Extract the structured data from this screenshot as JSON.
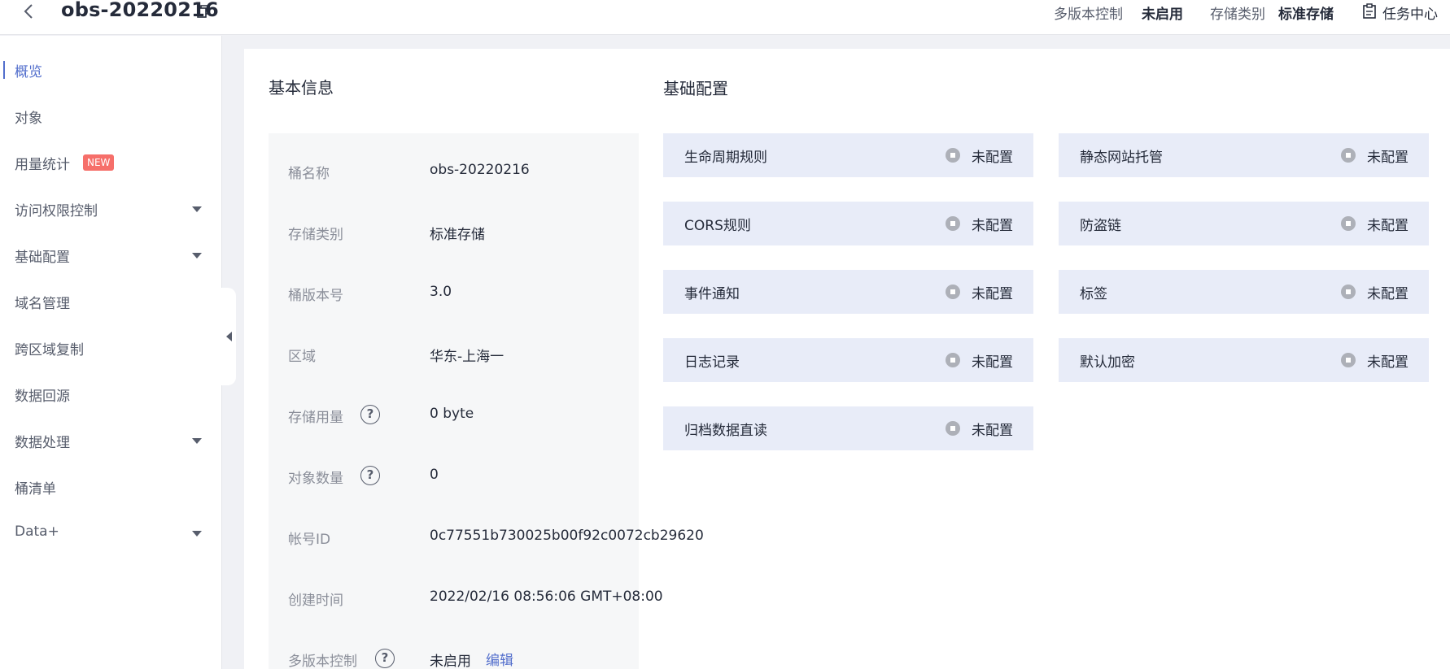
{
  "header": {
    "bucket_name": "obs-20220216",
    "versioning_label": "多版本控制",
    "versioning_value": "未启用",
    "storage_label": "存储类别",
    "storage_value": "标准存储",
    "task_center": "任务中心"
  },
  "sidebar": {
    "items": [
      {
        "label": "概览",
        "active": true
      },
      {
        "label": "对象"
      },
      {
        "label": "用量统计",
        "badge": "NEW"
      },
      {
        "label": "访问权限控制",
        "expandable": true
      },
      {
        "label": "基础配置",
        "expandable": true
      },
      {
        "label": "域名管理"
      },
      {
        "label": "跨区域复制"
      },
      {
        "label": "数据回源"
      },
      {
        "label": "数据处理",
        "expandable": true
      },
      {
        "label": "桶清单"
      },
      {
        "label": "Data+",
        "expandable": true
      }
    ]
  },
  "basic_info": {
    "title": "基本信息",
    "rows": [
      {
        "label": "桶名称",
        "value": "obs-20220216"
      },
      {
        "label": "存储类别",
        "value": "标准存储"
      },
      {
        "label": "桶版本号",
        "value": "3.0"
      },
      {
        "label": "区域",
        "value": "华东-上海一"
      },
      {
        "label": "存储用量",
        "value": "0 byte",
        "help": "?"
      },
      {
        "label": "对象数量",
        "value": "0",
        "help": "?"
      },
      {
        "label": "帐号ID",
        "value": "0c77551b730025b00f92c0072cb29620"
      },
      {
        "label": "创建时间",
        "value": "2022/02/16 08:56:06 GMT+08:00"
      },
      {
        "label": "多版本控制",
        "value": "未启用",
        "help": "?",
        "action": "编辑"
      }
    ]
  },
  "basic_config": {
    "title": "基础配置",
    "items": [
      {
        "name": "生命周期规则",
        "status": "未配置"
      },
      {
        "name": "静态网站托管",
        "status": "未配置"
      },
      {
        "name": "CORS规则",
        "status": "未配置"
      },
      {
        "name": "防盗链",
        "status": "未配置"
      },
      {
        "name": "事件通知",
        "status": "未配置"
      },
      {
        "name": "标签",
        "status": "未配置"
      },
      {
        "name": "日志记录",
        "status": "未配置"
      },
      {
        "name": "默认加密",
        "status": "未配置"
      },
      {
        "name": "归档数据直读",
        "status": "未配置"
      }
    ]
  },
  "colors": {
    "accent": "#526ecc",
    "badge": "#f66f6a",
    "config_card": "#e8ecf8"
  }
}
